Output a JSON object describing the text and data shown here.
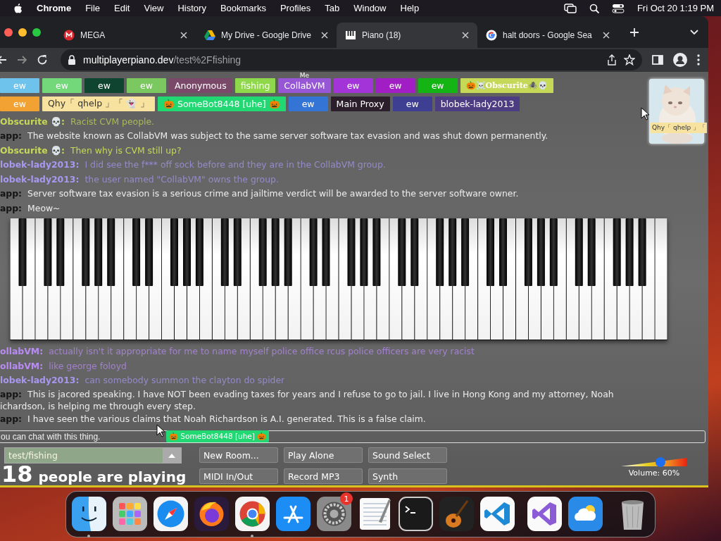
{
  "menu_bar": {
    "app": "Chrome",
    "menus": [
      "File",
      "Edit",
      "View",
      "History",
      "Bookmarks",
      "Profiles",
      "Tab",
      "Window",
      "Help"
    ],
    "clock": "Fri Oct 20  1:19 PM"
  },
  "tabs": [
    {
      "title": "MEGA",
      "selected": false
    },
    {
      "title": "My Drive - Google Drive",
      "selected": false
    },
    {
      "title": "Piano (18)",
      "selected": true
    },
    {
      "title": "halt doors - Google Sea",
      "selected": false
    }
  ],
  "address_bar": {
    "host": "multiplayerpiano.dev",
    "path": "/test%2Ffishing"
  },
  "user_rows": [
    [
      {
        "name": "ew",
        "color": "#6ec3ec"
      },
      {
        "name": "ew",
        "color": "#72d87a"
      },
      {
        "name": "ew",
        "color": "#0e4430"
      },
      {
        "name": "ew",
        "color": "#7cc860"
      },
      {
        "name": "Anonymous",
        "color": "#7a4868"
      },
      {
        "name": "fishing",
        "color": "#8fd84c"
      },
      {
        "name": "CollabVM",
        "color": "#9656d6",
        "tag": "Me"
      },
      {
        "name": "ew",
        "color": "#a234d8"
      },
      {
        "name": "ew",
        "color": "#a01ec4"
      },
      {
        "name": "ew",
        "color": "#14b414"
      },
      {
        "name": "🎃☠️Obscurite🕷️💀",
        "color": "#c6d858",
        "kind": "fancy"
      }
    ],
    [
      {
        "name": "ew",
        "color": "#f2a232"
      },
      {
        "name": "Qhy「 qhelp 」「 👻 」",
        "color": "#f8e2a0"
      },
      {
        "name": "🎃 SomeBot8448 [uhe] 🎃",
        "color": "#22d872"
      },
      {
        "name": "ew",
        "color": "#3474d4"
      },
      {
        "name": "Main Proxy",
        "color": "#2c1f2c"
      },
      {
        "name": "ew",
        "color": "#3e3e92"
      },
      {
        "name": "blobek-lady2013",
        "color": "#4c3c82"
      }
    ]
  ],
  "avatar_card": {
    "label": "Qhy「 qhelp 」「"
  },
  "chat_top": [
    {
      "name": "Obscurite 💀:",
      "color": "#c6d858",
      "kind": "tinted",
      "text": "Racist CVM people.",
      "faded": true
    },
    {
      "name": "app:",
      "color": "#141414",
      "kind": "plain",
      "text": "The website known as CollabVM was subject to the same server software tax evasion and was shut down permanently.",
      "faded": false
    },
    {
      "name": "Obscurite 💀:",
      "color": "#c6d858",
      "kind": "tinted",
      "text": "Then why is CVM still up?",
      "faded": false
    },
    {
      "name": "lobek-lady2013:",
      "color": "#a898f0",
      "kind": "tinted",
      "text": "I did see the f*** off sock before and they are in the CollabVM group.",
      "faded": true
    },
    {
      "name": "lobek-lady2013:",
      "color": "#a898f0",
      "kind": "tinted",
      "text": "the user named \"CollabVM\" owns the group.",
      "faded": true
    },
    {
      "name": "app:",
      "color": "#141414",
      "kind": "plain",
      "text": "Server software tax evasion is a serious crime and jailtime verdict will be awarded to the server software owner.",
      "faded": false
    },
    {
      "name": "app:",
      "color": "#141414",
      "kind": "plain",
      "text": "Meow~",
      "faded": false
    }
  ],
  "chat_bottom": [
    {
      "name": "ollabVM:",
      "color": "#b88cf4",
      "kind": "tinted",
      "text": "actually isn't it appropriate for me to name myself police office rcus police officers are very racist",
      "faded": true
    },
    {
      "name": "ollabVM:",
      "color": "#b88cf4",
      "kind": "tinted",
      "text": "like george foloyd",
      "faded": true
    },
    {
      "name": "lobek-lady2013:",
      "color": "#a898f0",
      "kind": "tinted",
      "text": "can somebody summon the clayton do spider",
      "faded": true
    },
    {
      "name": "app:",
      "color": "#141414",
      "kind": "plain",
      "text": "This is jacored speaking. I have NOT been evading taxes for years and I refuse to go to jail. I live in Hong Kong and my attorney, Noah",
      "continuation": "ichardson, is helping me through every step.",
      "faded": false
    },
    {
      "name": "app:",
      "color": "#141414",
      "kind": "plain",
      "text": "I have seen the various claims that Noah Richardson is A.I. generated. This is a false claim.",
      "faded": false
    }
  ],
  "chat_input": {
    "placeholder": "ou can chat with this thing.",
    "typing": {
      "name": "🎃 SomeBot8448 [uhe] 🎃",
      "color": "#22d872"
    }
  },
  "room": {
    "name": "test/fishing"
  },
  "player_count": {
    "count": "18",
    "label": "people are playing"
  },
  "buttons": [
    "New Room...",
    "Play Alone",
    "Sound Select",
    "MIDI In/Out",
    "Record MP3",
    "Synth"
  ],
  "volume": {
    "level": 0.6,
    "reading": "Volume: 60%"
  },
  "dock": [
    {
      "kind": "finder",
      "running": true
    },
    {
      "kind": "launchpad",
      "running": false
    },
    {
      "kind": "safari",
      "running": false
    },
    {
      "kind": "firefox",
      "running": false
    },
    {
      "kind": "chrome",
      "running": true
    },
    {
      "kind": "appstore",
      "running": false
    },
    {
      "kind": "settings",
      "running": false,
      "badge": "1"
    },
    {
      "kind": "textedit",
      "running": false
    },
    {
      "kind": "terminal",
      "running": false
    },
    {
      "kind": "garageband",
      "running": false
    },
    {
      "kind": "vscode",
      "running": false
    },
    {
      "kind": "divider"
    },
    {
      "kind": "visualstudio",
      "running": false
    },
    {
      "kind": "weather",
      "running": false
    },
    {
      "kind": "divider"
    },
    {
      "kind": "trash",
      "running": false
    }
  ]
}
